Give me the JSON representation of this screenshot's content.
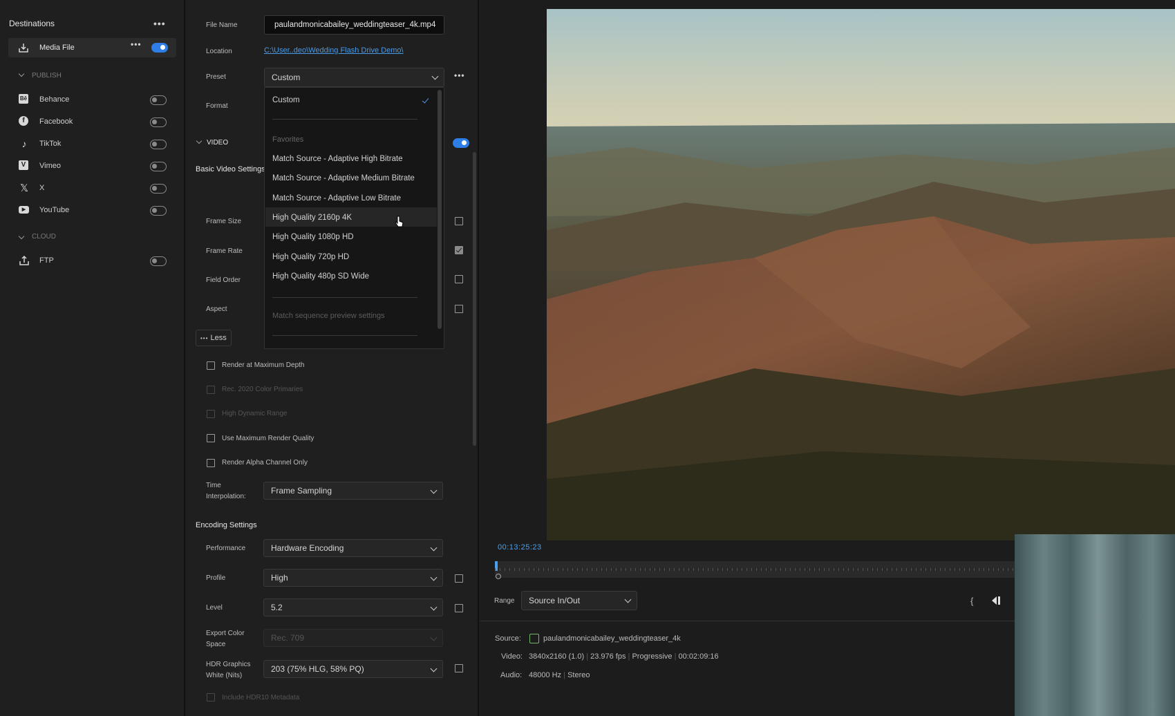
{
  "destinations": {
    "title": "Destinations",
    "media_file": {
      "label": "Media File",
      "enabled": true
    },
    "publish_header": "PUBLISH",
    "publish": [
      {
        "label": "Behance",
        "icon": "behance-icon",
        "enabled": false
      },
      {
        "label": "Facebook",
        "icon": "facebook-icon",
        "enabled": false
      },
      {
        "label": "TikTok",
        "icon": "tiktok-icon",
        "enabled": false
      },
      {
        "label": "Vimeo",
        "icon": "vimeo-icon",
        "enabled": false
      },
      {
        "label": "X",
        "icon": "x-icon",
        "enabled": false
      },
      {
        "label": "YouTube",
        "icon": "youtube-icon",
        "enabled": false
      }
    ],
    "cloud_header": "CLOUD",
    "cloud": [
      {
        "label": "FTP",
        "icon": "upload-icon",
        "enabled": false
      }
    ]
  },
  "settings": {
    "file_name_label": "File Name",
    "file_name_value": "paulandmonicabailey_weddingteaser_4k.mp4",
    "location_label": "Location",
    "location_value": "C:\\User..deo\\Wedding Flash Drive Demo\\",
    "preset_label": "Preset",
    "preset_value": "Custom",
    "format_label": "Format",
    "video_header": "VIDEO",
    "basic_video_settings": "Basic Video Settings",
    "frame_size_label": "Frame Size",
    "frame_rate_label": "Frame Rate",
    "field_order_label": "Field Order",
    "aspect_label": "Aspect",
    "less_button": "Less",
    "checkboxes": [
      {
        "label": "Render at Maximum Depth",
        "disabled": false
      },
      {
        "label": "Rec. 2020 Color Primaries",
        "disabled": true
      },
      {
        "label": "High Dynamic Range",
        "disabled": true
      },
      {
        "label": "Use Maximum Render Quality",
        "disabled": false
      },
      {
        "label": "Render Alpha Channel Only",
        "disabled": false
      }
    ],
    "time_interp_label_1": "Time",
    "time_interp_label_2": "Interpolation:",
    "time_interp_value": "Frame Sampling",
    "encoding_settings": "Encoding Settings",
    "performance_label": "Performance",
    "performance_value": "Hardware Encoding",
    "profile_label": "Profile",
    "profile_value": "High",
    "level_label": "Level",
    "level_value": "5.2",
    "export_color_label_1": "Export Color",
    "export_color_label_2": "Space",
    "export_color_value": "Rec. 709",
    "hdr_label_1": "HDR Graphics",
    "hdr_label_2": "White (Nits)",
    "hdr_value": "203 (75% HLG, 58% PQ)",
    "include_hdr10": "Include HDR10 Metadata"
  },
  "preset_dropdown": {
    "selected": "Custom",
    "favorites_header": "Favorites",
    "items": [
      "Match Source - Adaptive High Bitrate",
      "Match Source - Adaptive Medium Bitrate",
      "Match Source - Adaptive Low Bitrate",
      "High Quality 2160p 4K",
      "High Quality 1080p HD",
      "High Quality 720p HD",
      "High Quality 480p SD Wide"
    ],
    "hovered": "High Quality 2160p 4K",
    "match_sequence": "Match sequence preview settings"
  },
  "preview": {
    "timecode": "00:13:25:23",
    "range_label": "Range",
    "range_value": "Source In/Out",
    "source_label": "Source:",
    "source_value": "paulandmonicabailey_weddingteaser_4k",
    "video_label": "Video:",
    "video_res": "3840x2160 (1.0)",
    "video_fps": "23.976 fps",
    "video_scan": "Progressive",
    "video_duration": "00:02:09:16",
    "audio_label": "Audio:",
    "audio_rate": "48000 Hz",
    "audio_channels": "Stereo"
  },
  "colors": {
    "accent": "#2d7ee6",
    "link": "#4a9be8",
    "timecode": "#4aa0f0"
  }
}
